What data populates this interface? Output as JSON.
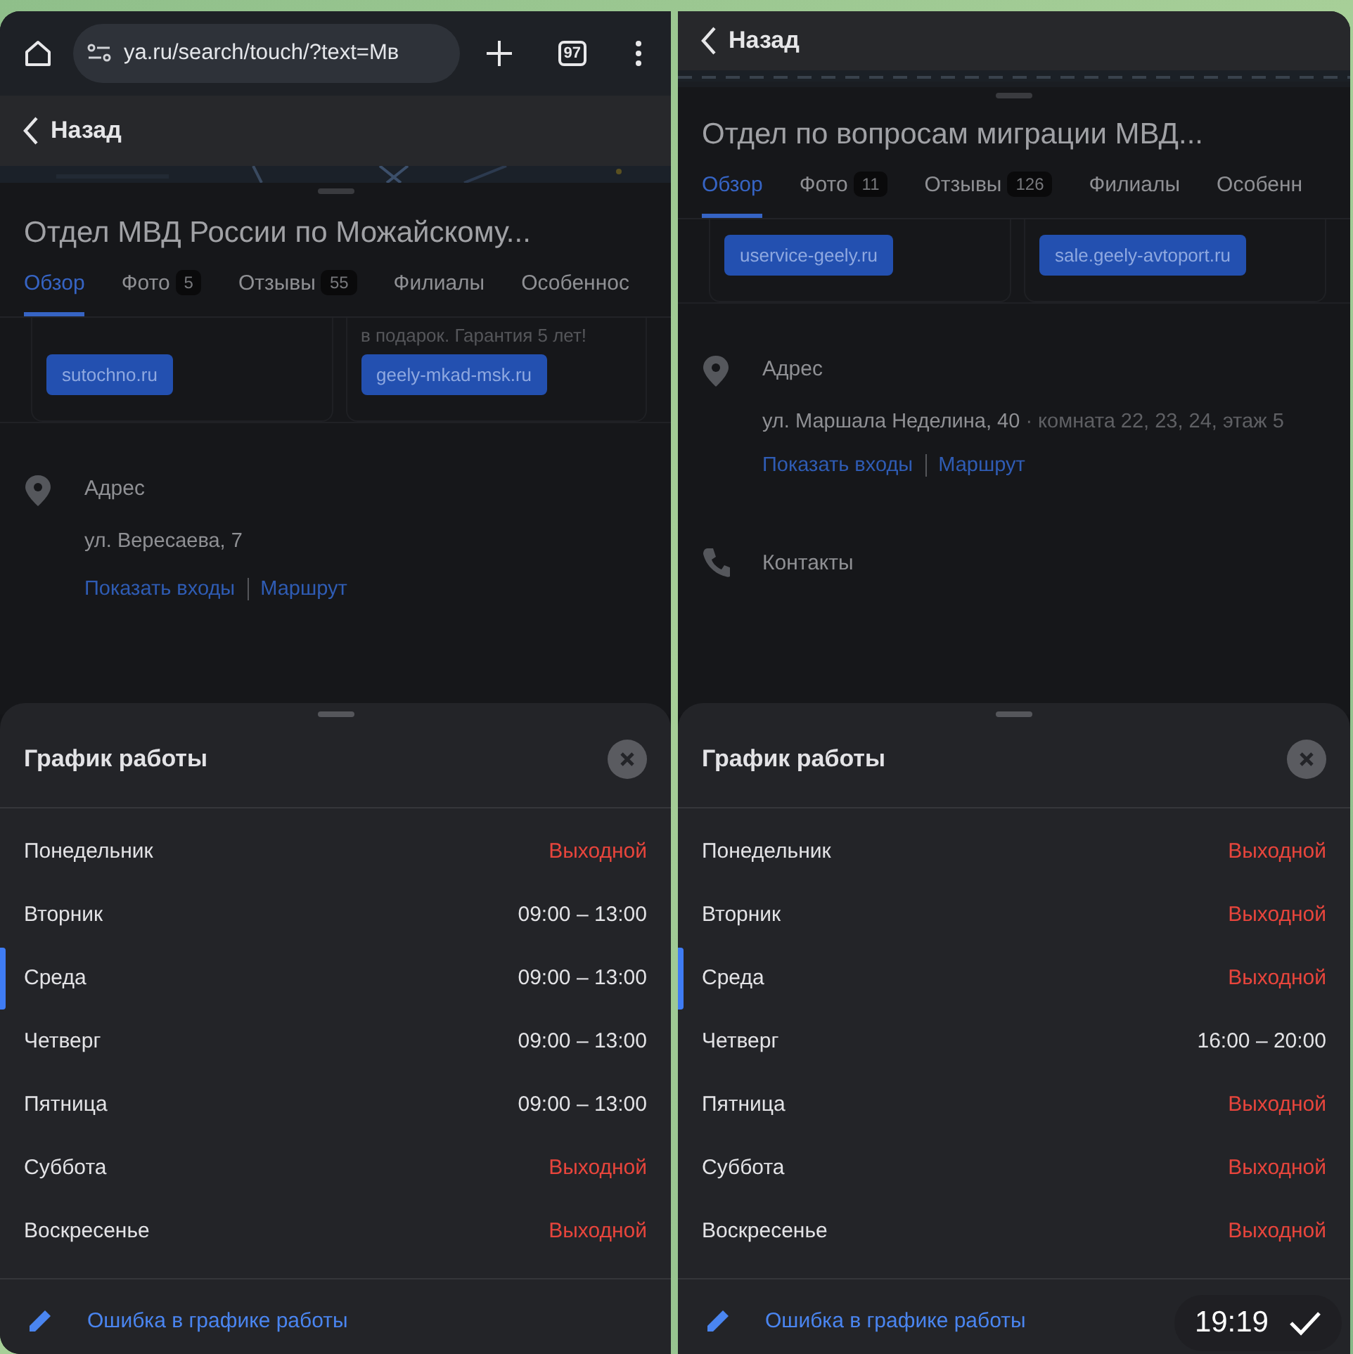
{
  "panels": [
    {
      "browser_bar": {
        "url": "ya.ru/search/touch/?text=Мв",
        "tab_count": "97"
      },
      "back_label": "Назад",
      "title": "Отдел МВД России по Можайскому...",
      "tabs": [
        {
          "label": "Обзор",
          "selected": true
        },
        {
          "label": "Фото",
          "count": "5",
          "selected": false
        },
        {
          "label": "Отзывы",
          "count": "55",
          "selected": false
        },
        {
          "label": "Филиалы",
          "selected": false
        },
        {
          "label": "Особенноc",
          "selected": false
        }
      ],
      "ads": [
        {
          "link": "sutochno.ru"
        },
        {
          "text": "в подарок. Гарантия 5 лет!",
          "link": "geely-mkad-msk.ru"
        }
      ],
      "address": {
        "label": "Адрес",
        "street": "ул. Вересаева, 7",
        "links": [
          "Показать входы",
          "Маршрут"
        ]
      },
      "schedule": {
        "title": "График работы",
        "days": [
          {
            "day": "Понедельник",
            "hours": "Выходной",
            "kind": "closed",
            "selected": false
          },
          {
            "day": "Вторник",
            "hours": "09:00 – 13:00",
            "kind": "open",
            "selected": false
          },
          {
            "day": "Среда",
            "hours": "09:00 – 13:00",
            "kind": "open",
            "selected": true
          },
          {
            "day": "Четверг",
            "hours": "09:00 – 13:00",
            "kind": "open",
            "selected": false
          },
          {
            "day": "Пятница",
            "hours": "09:00 – 13:00",
            "kind": "open",
            "selected": false
          },
          {
            "day": "Суббота",
            "hours": "Выходной",
            "kind": "closed",
            "selected": false
          },
          {
            "day": "Воскресенье",
            "hours": "Выходной",
            "kind": "closed",
            "selected": false
          }
        ],
        "report": "Ошибка в графике работы"
      }
    },
    {
      "back_label": "Назад",
      "title": "Отдел по вопросам миграции МВД...",
      "tabs": [
        {
          "label": "Обзор",
          "selected": true
        },
        {
          "label": "Фото",
          "count": "11",
          "selected": false
        },
        {
          "label": "Отзывы",
          "count": "126",
          "selected": false
        },
        {
          "label": "Филиалы",
          "selected": false
        },
        {
          "label": "Особенн",
          "selected": false
        }
      ],
      "ads": [
        {
          "link": "uservice-geely.ru"
        },
        {
          "link": "sale.geely-avtoport.ru"
        }
      ],
      "address": {
        "label": "Адрес",
        "street": "ул. Маршала Неделина, 40",
        "detail": "· комната 22, 23, 24, этаж 5",
        "links": [
          "Показать входы",
          "Маршрут"
        ]
      },
      "contacts": {
        "label": "Контакты"
      },
      "schedule": {
        "title": "График работы",
        "days": [
          {
            "day": "Понедельник",
            "hours": "Выходной",
            "kind": "closed",
            "selected": false
          },
          {
            "day": "Вторник",
            "hours": "Выходной",
            "kind": "closed",
            "selected": false
          },
          {
            "day": "Среда",
            "hours": "Выходной",
            "kind": "closed",
            "selected": true
          },
          {
            "day": "Четверг",
            "hours": "16:00 – 20:00",
            "kind": "open",
            "selected": false
          },
          {
            "day": "Пятница",
            "hours": "Выходной",
            "kind": "closed",
            "selected": false
          },
          {
            "day": "Суббота",
            "hours": "Выходной",
            "kind": "closed",
            "selected": false
          },
          {
            "day": "Воскресенье",
            "hours": "Выходной",
            "kind": "closed",
            "selected": false
          }
        ],
        "report": "Ошибка в графике работы"
      }
    }
  ],
  "message": {
    "time": "19:19",
    "read": true
  }
}
